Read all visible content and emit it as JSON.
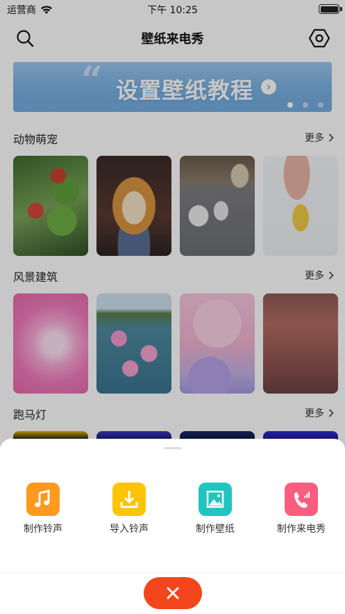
{
  "status_bar": {
    "carrier": "运营商",
    "time": "下午 10:25"
  },
  "navbar": {
    "title": "壁纸来电秀",
    "left_icon": "search-icon",
    "right_icon": "settings-hex-icon"
  },
  "banner": {
    "text": "设置壁纸教程",
    "pages": 3,
    "active_page": 1
  },
  "sections": [
    {
      "name": "动物萌宠",
      "more": "更多"
    },
    {
      "name": "风景建筑",
      "more": "更多"
    },
    {
      "name": "跑马灯",
      "more": "更多"
    }
  ],
  "sheet": {
    "actions": [
      {
        "label": "制作铃声",
        "icon": "music-note-icon",
        "color": "#ff9a1f"
      },
      {
        "label": "导入铃声",
        "icon": "download-icon",
        "color": "#ffc400"
      },
      {
        "label": "制作壁纸",
        "icon": "image-icon",
        "color": "#22c4c0"
      },
      {
        "label": "制作来电秀",
        "icon": "phone-call-icon",
        "color": "#ff5d7f"
      }
    ],
    "close_icon": "close-icon",
    "close_color": "#f2451b"
  }
}
